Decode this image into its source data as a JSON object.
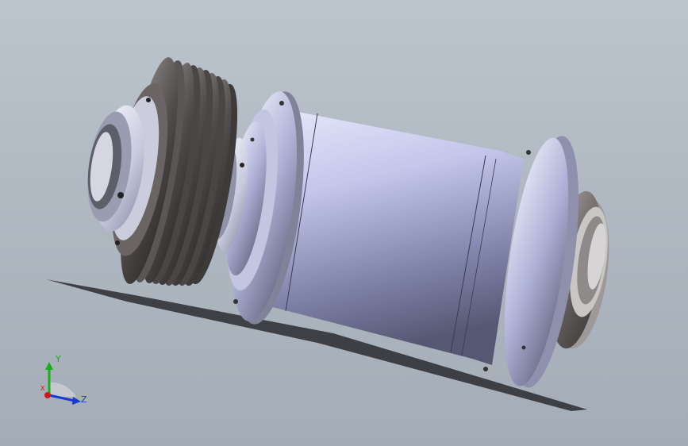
{
  "viewport": {
    "background_top": "#bcc4cd",
    "background_bottom": "#a4acb7"
  },
  "model": {
    "parts": [
      "pulley-icon",
      "clamp-collar-icon",
      "spindle-housing-icon",
      "front-flange-icon",
      "rear-flange-icon",
      "end-cap-icon",
      "shadow"
    ],
    "colors": {
      "housing": "#a9acd6",
      "pulley": "#5a5656",
      "collar": "#d2d4e6",
      "end_cap": "#6e6868"
    }
  },
  "triad": {
    "y_label": "Y",
    "z_label": "Z",
    "x_label": "X",
    "colors": {
      "x": "#d01818",
      "y": "#18b018",
      "z": "#1838d8"
    }
  }
}
